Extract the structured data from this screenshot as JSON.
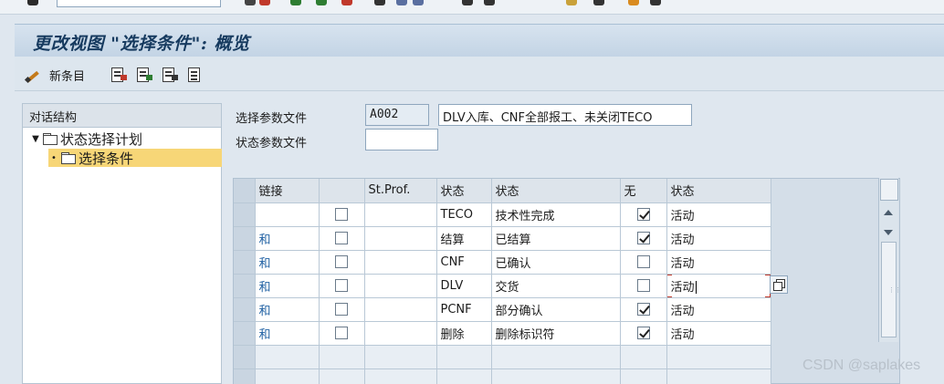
{
  "title": "更改视图 \"选择条件\": 概览",
  "toolbar": {
    "new_entries_label": "新条目"
  },
  "tree": {
    "header": "对话结构",
    "items": [
      {
        "label": "状态选择计划",
        "level": 0,
        "expanded": true,
        "selected": false
      },
      {
        "label": "选择条件",
        "level": 1,
        "selected": true
      }
    ]
  },
  "form": {
    "sel_profile_label": "选择参数文件",
    "sel_profile_value": "A002",
    "sel_profile_desc": "DLV入库、CNF全部报工、未关闭TECO",
    "status_profile_label": "状态参数文件",
    "status_profile_value": ""
  },
  "table": {
    "headers": [
      "链接",
      "",
      "St.Prof.",
      "状态",
      "状态",
      "无",
      "状态"
    ],
    "rows": [
      {
        "link": "",
        "flag": false,
        "stprof": "",
        "status": "TECO",
        "desc": "技术性完成",
        "none": true,
        "state": "活动"
      },
      {
        "link": "和",
        "flag": false,
        "stprof": "",
        "status": "结算",
        "desc": "已结算",
        "none": true,
        "state": "活动"
      },
      {
        "link": "和",
        "flag": false,
        "stprof": "",
        "status": "CNF",
        "desc": "已确认",
        "none": false,
        "state": "活动"
      },
      {
        "link": "和",
        "flag": false,
        "stprof": "",
        "status": "DLV",
        "desc": "交货",
        "none": false,
        "state": "活动"
      },
      {
        "link": "和",
        "flag": false,
        "stprof": "",
        "status": "PCNF",
        "desc": "部分确认",
        "none": true,
        "state": "活动"
      },
      {
        "link": "和",
        "flag": false,
        "stprof": "",
        "status": "删除",
        "desc": "删除标识符",
        "none": true,
        "state": "活动"
      }
    ]
  },
  "watermark": "CSDN @saplakes",
  "colors": {
    "title_text": "#163a5f",
    "selection": "#f7d677",
    "link": "#1e5fa2",
    "focus": "#c0392b"
  }
}
